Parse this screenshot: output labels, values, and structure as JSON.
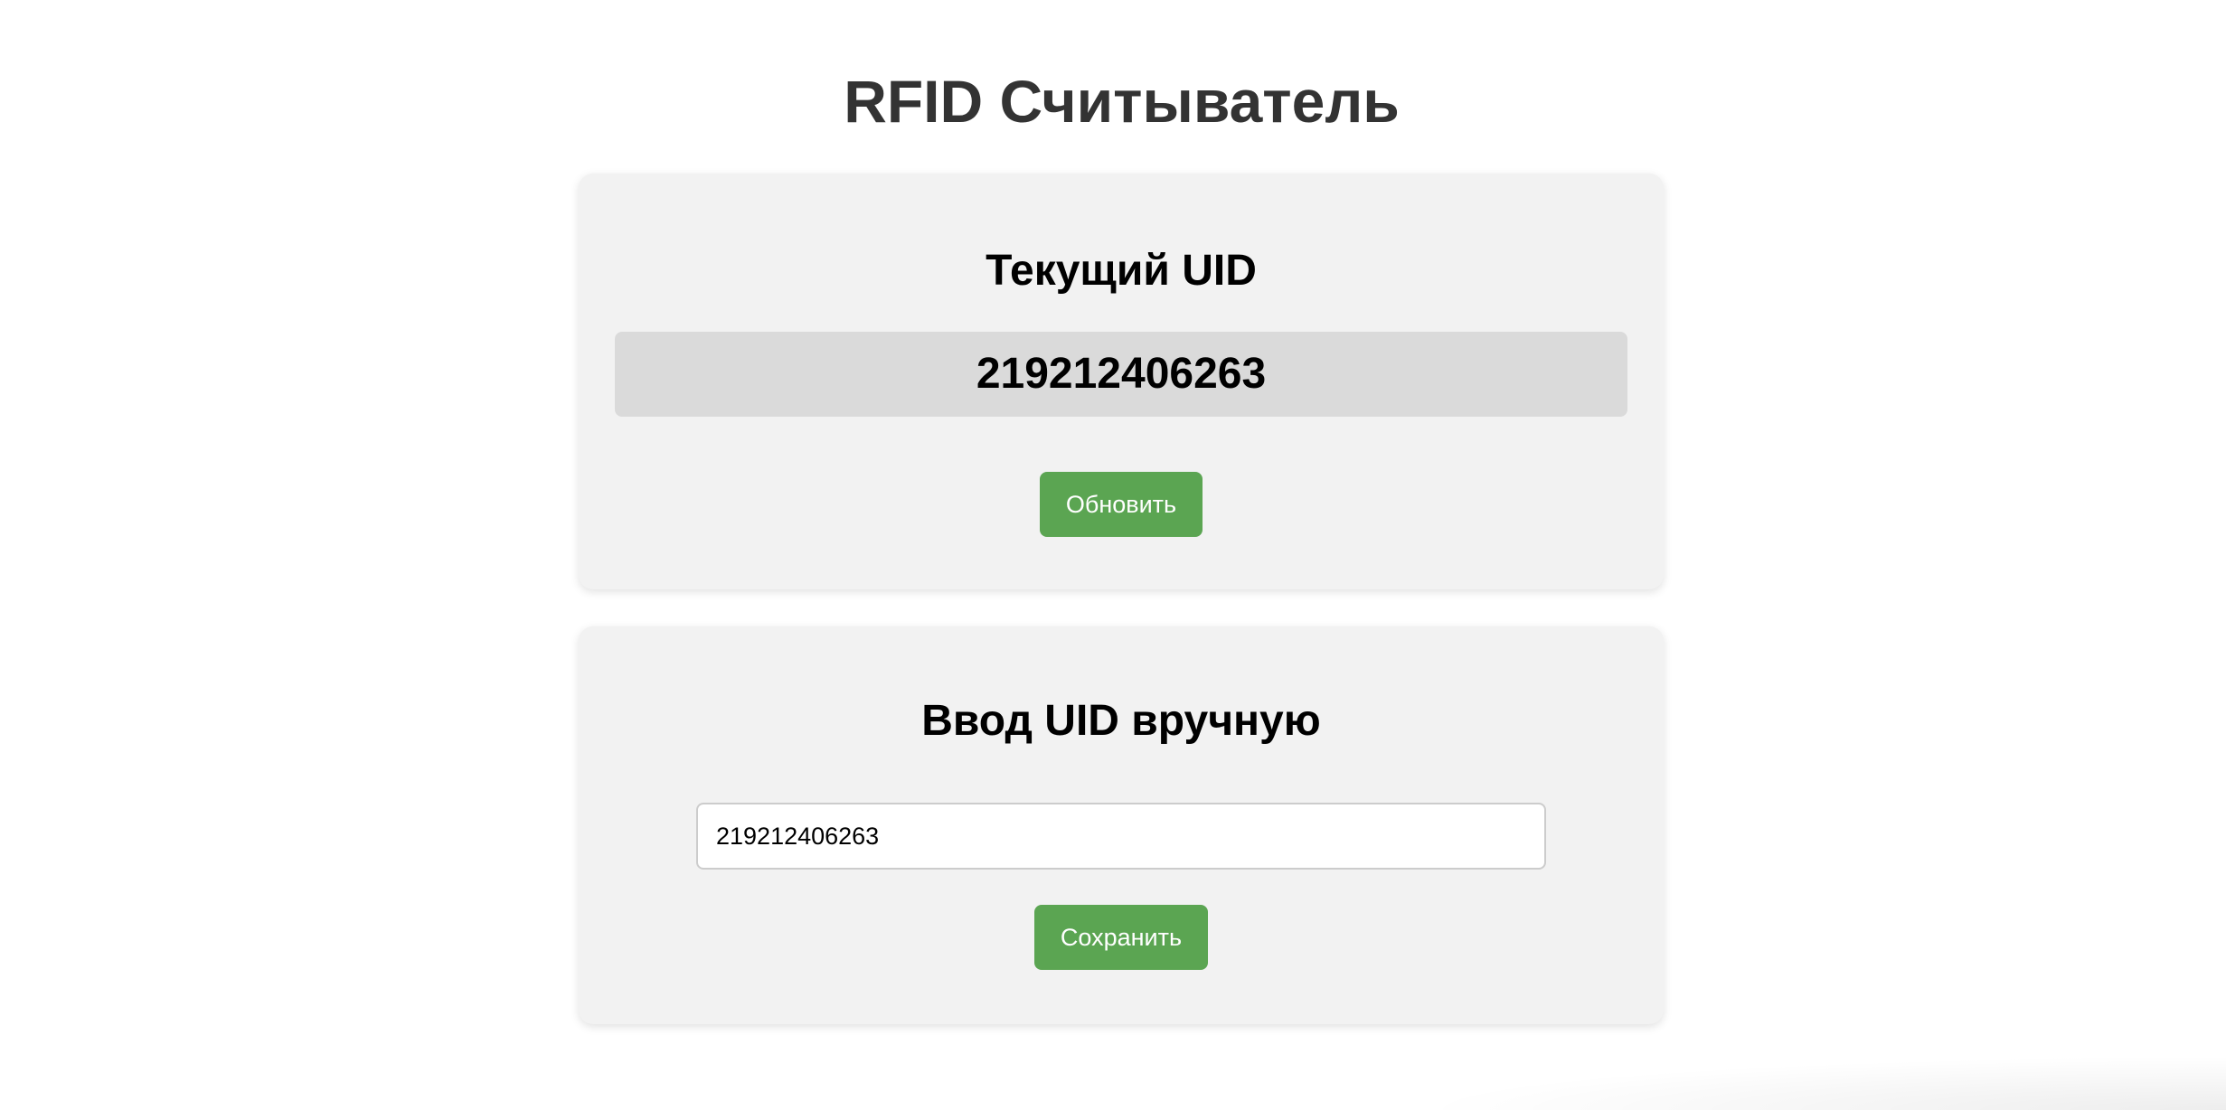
{
  "page": {
    "title": "RFID Считыватель"
  },
  "current_uid_card": {
    "heading": "Текущий UID",
    "uid_value": "219212406263",
    "refresh_label": "Обновить"
  },
  "manual_card": {
    "heading": "Ввод UID вручную",
    "input_value": "219212406263",
    "save_label": "Сохранить"
  },
  "colors": {
    "accent_button": "#5ba552",
    "card_background": "#f2f2f2",
    "uid_display_background": "#dadada",
    "title_text": "#333333"
  }
}
